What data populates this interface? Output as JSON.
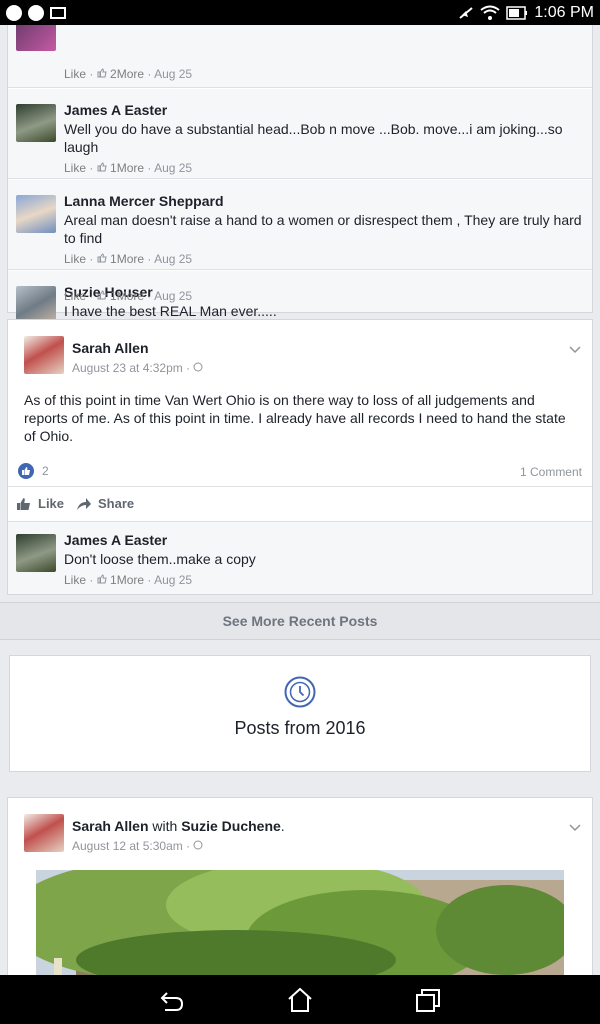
{
  "status_bar": {
    "time": "1:06 PM"
  },
  "top_comments": [
    {
      "name": "",
      "text": "",
      "like": "Like",
      "reactions": "2More",
      "date": "Aug 25"
    },
    {
      "name": "James A Easter",
      "text": "Well you do have a substantial head...Bob n move ...Bob. move...i am joking...so laugh",
      "like": "Like",
      "reactions": "1More",
      "date": "Aug 25"
    },
    {
      "name": "Lanna Mercer Sheppard",
      "text": "Areal man doesn't raise a hand to a women or disrespect them , They are truly hard to find",
      "like": "Like",
      "reactions": "1More",
      "date": "Aug 25"
    },
    {
      "name": "Suzie Houser",
      "text": "I have the best REAL Man ever.....",
      "like": "Like",
      "reactions": "1More",
      "date": "Aug 25"
    }
  ],
  "post1": {
    "author": "Sarah Allen",
    "date": "August 23 at 4:32pm",
    "body": "As of this point in time Van Wert Ohio is on there way to loss of all judgements and reports of me. As of this point in time. I already have all records I need to hand the state of Ohio.",
    "like_count": "2",
    "comments_count": "1 Comment",
    "like_label": "Like",
    "share_label": "Share",
    "comment": {
      "name": "James A Easter",
      "text": "Don't loose them..make a copy",
      "like": "Like",
      "reactions": "1More",
      "date": "Aug 25"
    }
  },
  "see_more_label": "See More Recent Posts",
  "year_section": {
    "label": "Posts from 2016"
  },
  "post2": {
    "author": "Sarah Allen",
    "with_word": "with",
    "tagged": "Suzie Duchene",
    "period": ".",
    "date": "August 12 at 5:30am"
  },
  "colors": {
    "brand": "#4267b2",
    "meta": "#90949c",
    "bg": "#e9ebee"
  }
}
